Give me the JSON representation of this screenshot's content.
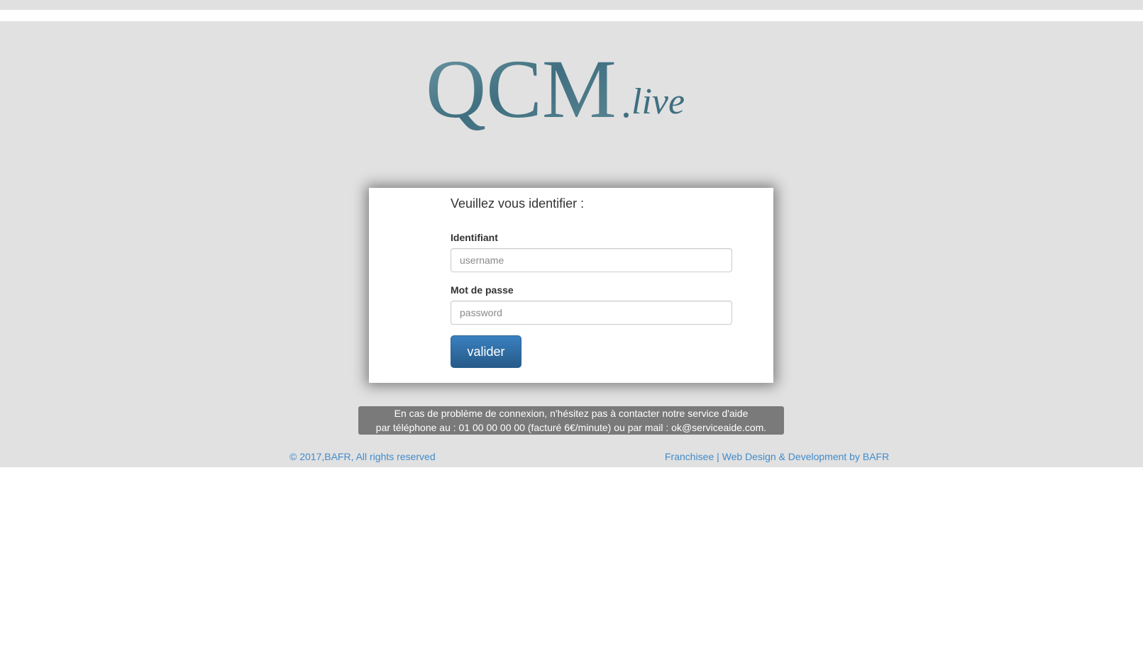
{
  "logo": {
    "main": "QCM",
    "dot": ".",
    "sub": "live"
  },
  "login": {
    "title": "Veuillez vous identifier :",
    "username_label": "Identifiant",
    "username_placeholder": "username",
    "username_value": "",
    "password_label": "Mot de passe",
    "password_placeholder": "password",
    "password_value": "",
    "submit_label": "valider"
  },
  "help": {
    "line1": "En cas de problème de connexion, n'hésitez pas à contacter notre service d'aide",
    "line2": "par téléphone au : 01 00 00 00 00 (facturé 6€/minute) ou par mail : ok@serviceaide.com."
  },
  "footer": {
    "copyright": "© 2017,BAFR, All rights reserved",
    "franchisee": "Franchisee",
    "separator": " | ",
    "credits": "Web Design & Development by BAFR"
  },
  "colors": {
    "background": "#e1e1e1",
    "button": "#337ab7",
    "link": "#428bca",
    "help_box": "#7a7a7a",
    "logo_ink": "#4d7d8c"
  }
}
